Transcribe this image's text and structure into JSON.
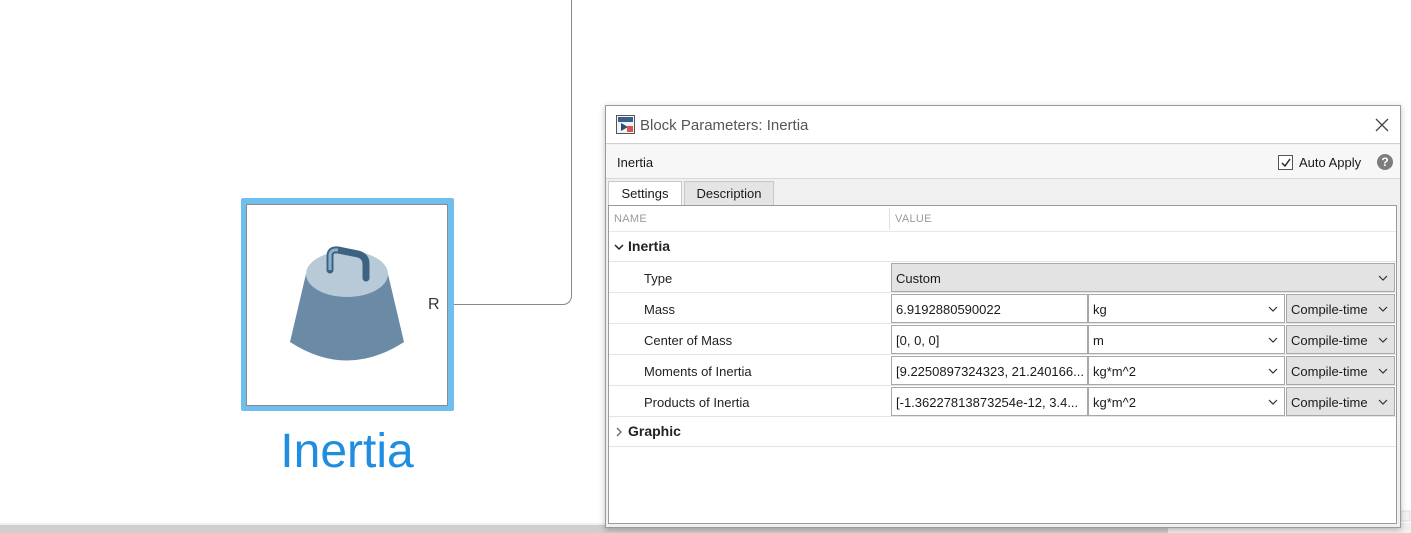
{
  "canvas": {
    "block_name": "Inertia",
    "port_label": "R"
  },
  "dialog": {
    "title": "Block Parameters: Inertia",
    "block_type": "Inertia",
    "auto_apply_label": "Auto Apply",
    "auto_apply_checked": true,
    "help_glyph": "?",
    "tabs": [
      {
        "label": "Settings",
        "active": true
      },
      {
        "label": "Description",
        "active": false
      }
    ],
    "columns": {
      "name": "NAME",
      "value": "VALUE"
    },
    "groups": [
      {
        "label": "Inertia",
        "expanded": true
      },
      {
        "label": "Graphic",
        "expanded": false
      }
    ],
    "params": {
      "type": {
        "name": "Type",
        "value": "Custom"
      },
      "mass": {
        "name": "Mass",
        "value": "6.9192880590022",
        "unit": "kg",
        "config": "Compile-time"
      },
      "com": {
        "name": "Center of Mass",
        "value": "[0, 0, 0]",
        "unit": "m",
        "config": "Compile-time"
      },
      "moi": {
        "name": "Moments of Inertia",
        "value": "[9.2250897324323, 21.240166...",
        "unit": "kg*m^2",
        "config": "Compile-time"
      },
      "poi": {
        "name": "Products of Inertia",
        "value": "[-1.36227813873254e-12, 3.4...",
        "unit": "kg*m^2",
        "config": "Compile-time"
      }
    }
  },
  "icons": [
    "matlab-block-icon",
    "close-icon",
    "checkbox-check-icon",
    "help-icon",
    "chevron-down-icon",
    "chevron-right-icon",
    "dropdown-arrow-icon",
    "inertia-weight-icon"
  ],
  "colors": {
    "selection": "#6fbfee",
    "block_label": "#1f8ee0",
    "weight_body": "#6b8aa6",
    "weight_top": "#b8cad8"
  }
}
